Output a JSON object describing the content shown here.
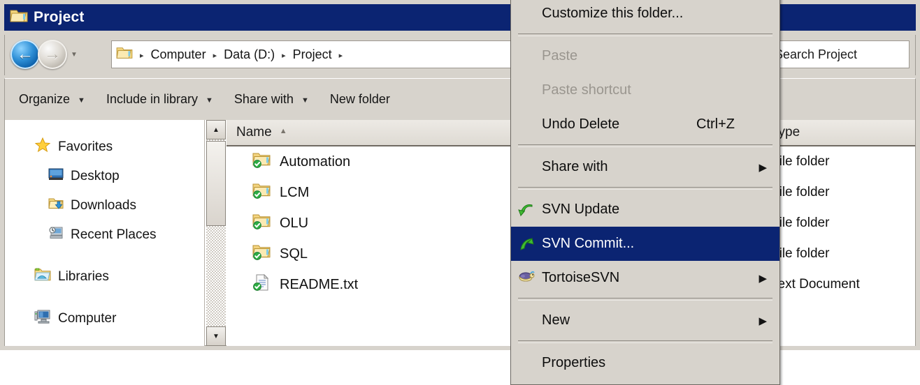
{
  "window": {
    "title": "Project",
    "title_icon": "folder-icon",
    "titlebar_color": "#0b2472"
  },
  "nav": {
    "back_label": "←",
    "forward_label": "→",
    "history_caret": "▼",
    "breadcrumb": {
      "icon": "folder-icon",
      "separator": "▸",
      "items": [
        "Computer",
        "Data (D:)",
        "Project"
      ],
      "trailing_separator": "▸"
    }
  },
  "search": {
    "value": "Search Project",
    "placeholder": "Search Project"
  },
  "toolbar": {
    "items": [
      {
        "label": "Organize",
        "caret": "▼"
      },
      {
        "label": "Include in library",
        "caret": "▼"
      },
      {
        "label": "Share with",
        "caret": "▼"
      },
      {
        "label": "New folder",
        "caret": ""
      }
    ]
  },
  "tree": {
    "groups": [
      {
        "label": "Favorites",
        "icon": "star-icon",
        "children": [
          {
            "label": "Desktop",
            "icon": "desktop-icon"
          },
          {
            "label": "Downloads",
            "icon": "downloads-folder-icon"
          },
          {
            "label": "Recent Places",
            "icon": "recent-places-icon"
          }
        ]
      },
      {
        "label": "Libraries",
        "icon": "libraries-icon",
        "children": []
      },
      {
        "label": "Computer",
        "icon": "computer-icon",
        "children": []
      }
    ]
  },
  "list": {
    "columns": [
      {
        "label": "Name",
        "sort": "▲"
      },
      {
        "label": "Type",
        "sort": ""
      }
    ],
    "rows": [
      {
        "name": "Automation",
        "type": "File folder",
        "icon": "folder-svn-ok-icon"
      },
      {
        "name": "LCM",
        "type": "File folder",
        "icon": "folder-svn-ok-icon"
      },
      {
        "name": "OLU",
        "type": "File folder",
        "icon": "folder-svn-ok-icon"
      },
      {
        "name": "SQL",
        "type": "File folder",
        "icon": "folder-svn-ok-icon"
      },
      {
        "name": "README.txt",
        "type": "Text Document",
        "icon": "textfile-svn-ok-icon"
      }
    ]
  },
  "scrollbars": {
    "up_glyph": "▲",
    "down_glyph": "▼"
  },
  "context_menu": {
    "highlight_color": "#0b2472",
    "items": [
      {
        "id": "customize-this-folder",
        "label": "Customize this folder...",
        "icon": "",
        "shortcut": "",
        "submenu": false,
        "disabled": false,
        "selected": false
      },
      {
        "id": "separator-1",
        "type": "separator"
      },
      {
        "id": "paste",
        "label": "Paste",
        "icon": "",
        "shortcut": "",
        "submenu": false,
        "disabled": true,
        "selected": false
      },
      {
        "id": "paste-shortcut",
        "label": "Paste shortcut",
        "icon": "",
        "shortcut": "",
        "submenu": false,
        "disabled": true,
        "selected": false
      },
      {
        "id": "undo-delete",
        "label": "Undo Delete",
        "icon": "",
        "shortcut": "Ctrl+Z",
        "submenu": false,
        "disabled": false,
        "selected": false
      },
      {
        "id": "separator-2",
        "type": "separator"
      },
      {
        "id": "share-with",
        "label": "Share with",
        "icon": "",
        "shortcut": "",
        "submenu": true,
        "disabled": false,
        "selected": false
      },
      {
        "id": "separator-3",
        "type": "separator"
      },
      {
        "id": "svn-update",
        "label": "SVN Update",
        "icon": "svn-update-icon",
        "shortcut": "",
        "submenu": false,
        "disabled": false,
        "selected": false
      },
      {
        "id": "svn-commit",
        "label": "SVN Commit...",
        "icon": "svn-commit-icon",
        "shortcut": "",
        "submenu": false,
        "disabled": false,
        "selected": true
      },
      {
        "id": "tortoisesvn",
        "label": "TortoiseSVN",
        "icon": "tortoise-icon",
        "shortcut": "",
        "submenu": true,
        "disabled": false,
        "selected": false
      },
      {
        "id": "separator-4",
        "type": "separator"
      },
      {
        "id": "new",
        "label": "New",
        "icon": "",
        "shortcut": "",
        "submenu": true,
        "disabled": false,
        "selected": false
      },
      {
        "id": "separator-5",
        "type": "separator"
      },
      {
        "id": "properties",
        "label": "Properties",
        "icon": "",
        "shortcut": "",
        "submenu": false,
        "disabled": false,
        "selected": false
      }
    ],
    "submenu_glyph": "▶"
  }
}
